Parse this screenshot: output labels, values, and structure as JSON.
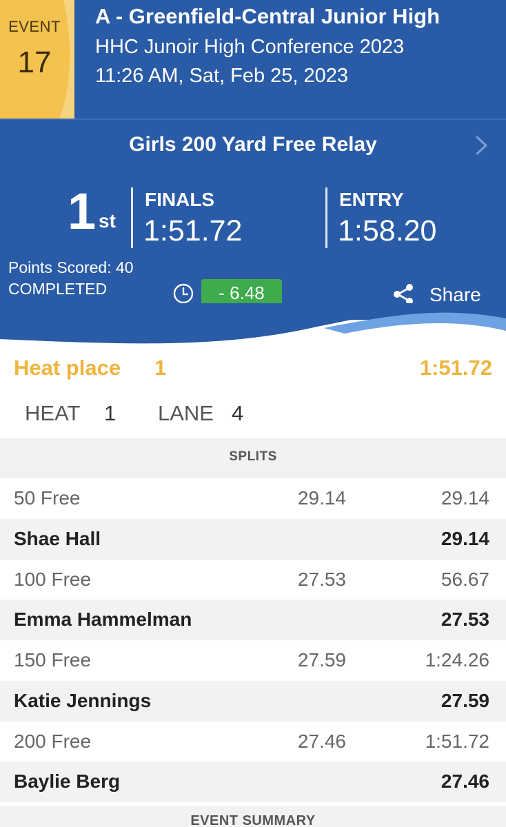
{
  "meet": {
    "event_word": "EVENT",
    "event_number": "17",
    "title": "A - Greenfield-Central Junior High",
    "subtitle": "HHC Junoir High Conference 2023",
    "datetime": "11:26 AM, Sat, Feb 25, 2023"
  },
  "event": {
    "name": "Girls 200 Yard Free Relay",
    "place_number": "1",
    "place_suffix": "st",
    "finals_label": "FINALS",
    "finals_time": "1:51.72",
    "entry_label": "ENTRY",
    "entry_time": "1:58.20",
    "points": "Points Scored: 40",
    "status": "COMPLETED",
    "time_diff": "- 6.48",
    "share_label": "Share"
  },
  "heat": {
    "place_label": "Heat place",
    "place_value": "1",
    "time": "1:51.72",
    "heat_label": "HEAT",
    "heat_value": "1",
    "lane_label": "LANE",
    "lane_value": "4"
  },
  "splits": {
    "header": "SPLITS",
    "rows": [
      {
        "type": "split",
        "label": "50 Free",
        "split": "29.14",
        "cumulative": "29.14"
      },
      {
        "type": "swimmer",
        "label": "Shae Hall",
        "split": "",
        "cumulative": "29.14"
      },
      {
        "type": "split",
        "label": "100 Free",
        "split": "27.53",
        "cumulative": "56.67"
      },
      {
        "type": "swimmer",
        "label": "Emma Hammelman",
        "split": "",
        "cumulative": "27.53"
      },
      {
        "type": "split",
        "label": "150 Free",
        "split": "27.59",
        "cumulative": "1:24.26"
      },
      {
        "type": "swimmer",
        "label": "Katie Jennings",
        "split": "",
        "cumulative": "27.59"
      },
      {
        "type": "split",
        "label": "200 Free",
        "split": "27.46",
        "cumulative": "1:51.72"
      },
      {
        "type": "swimmer",
        "label": "Baylie Berg",
        "split": "",
        "cumulative": "27.46"
      }
    ]
  },
  "summary_header": "EVENT SUMMARY",
  "colors": {
    "primary_blue": "#2a5ba6",
    "badge_yellow": "#f3c24f",
    "accent_orange": "#f0b43e",
    "improvement_green": "#3eab4c"
  }
}
